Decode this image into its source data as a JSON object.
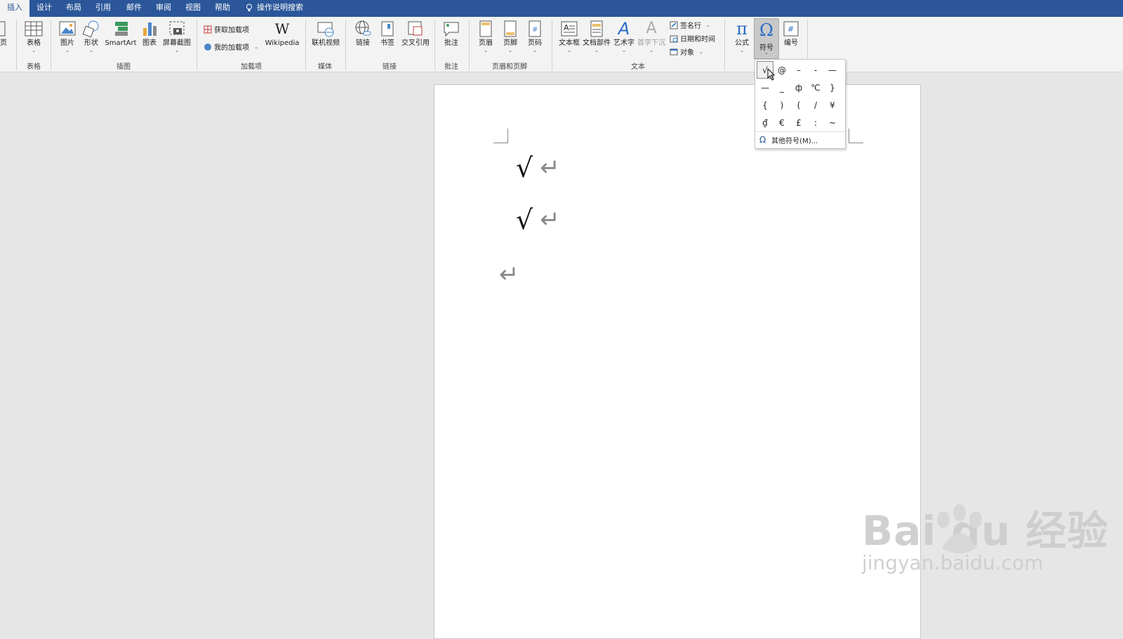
{
  "tabs": [
    {
      "label": "插入",
      "active": true
    },
    {
      "label": "设计"
    },
    {
      "label": "布局"
    },
    {
      "label": "引用"
    },
    {
      "label": "邮件"
    },
    {
      "label": "审阅"
    },
    {
      "label": "视图"
    },
    {
      "label": "帮助"
    },
    {
      "label": "操作说明搜索",
      "icon": "lightbulb-icon"
    }
  ],
  "ribbon": {
    "pages_partial_label": "页",
    "table": {
      "button": "表格",
      "group": "表格"
    },
    "illustrations": {
      "picture": "图片",
      "shapes": "形状",
      "smartart": "SmartArt",
      "chart": "图表",
      "screenshot": "屏幕截图",
      "group": "插图"
    },
    "addins": {
      "get": "获取加载项",
      "mine": "我的加载项",
      "wikipedia": "Wikipedia",
      "wikipedia_icon_text": "W",
      "group": "加载项"
    },
    "media": {
      "online_video": "联机视频",
      "group": "媒体"
    },
    "links": {
      "link": "链接",
      "bookmark": "书签",
      "crossref": "交叉引用",
      "group": "链接"
    },
    "comments": {
      "comment": "批注",
      "group": "批注"
    },
    "header_footer": {
      "header": "页眉",
      "footer": "页脚",
      "page_number": "页码",
      "group": "页眉和页脚"
    },
    "text": {
      "textbox": "文本框",
      "quickparts": "文档部件",
      "wordart": "艺术字",
      "dropcap": "首字下沉",
      "signature": "签名行",
      "datetime": "日期和时间",
      "object": "对象",
      "group": "文本"
    },
    "symbols": {
      "equation": "公式",
      "symbol": "符号",
      "numbering": "编号"
    }
  },
  "document": {
    "lines": [
      {
        "text": "√",
        "mark": "↵"
      },
      {
        "text": "√",
        "mark": "↵"
      },
      {
        "text": "",
        "mark": "↵"
      }
    ]
  },
  "symbol_dropdown": {
    "symbols": [
      "√",
      "@",
      "–",
      "-",
      "—",
      "—",
      "_",
      "ф",
      "℃",
      "}",
      "{",
      ")",
      "(",
      "/",
      "¥",
      "₫",
      "€",
      "£",
      ":",
      "~"
    ],
    "selected_index": 0,
    "more_label": "其他符号(M)...",
    "more_icon": "Ω"
  },
  "watermark": {
    "brand": "Bai du 经验",
    "url": "jingyan.baidu.com"
  },
  "colors": {
    "accent": "#2b579a",
    "ribbon_bg": "#f3f3f3",
    "canvas_bg": "#e6e6e6"
  }
}
